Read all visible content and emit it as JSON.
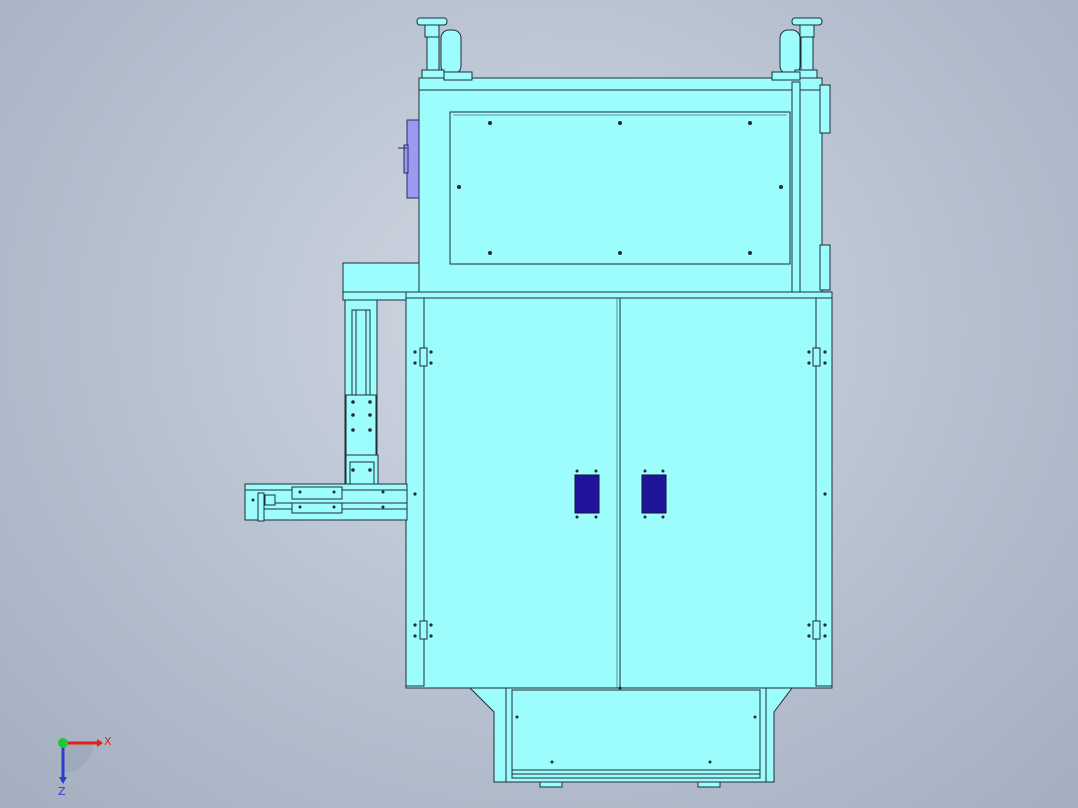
{
  "viewport": {
    "background_top": "#d2d8e3",
    "background_bottom": "#a3aebf"
  },
  "model": {
    "body_color": "#9dfcfc",
    "edge_color": "#1e2e38",
    "panel_color": "#20149a",
    "handle_color": "#9a9af0"
  },
  "triad": {
    "x_label": "X",
    "z_label": "Z",
    "x_color": "#e0201a",
    "y_color": "#21c63a",
    "z_color": "#2c3ccb"
  }
}
